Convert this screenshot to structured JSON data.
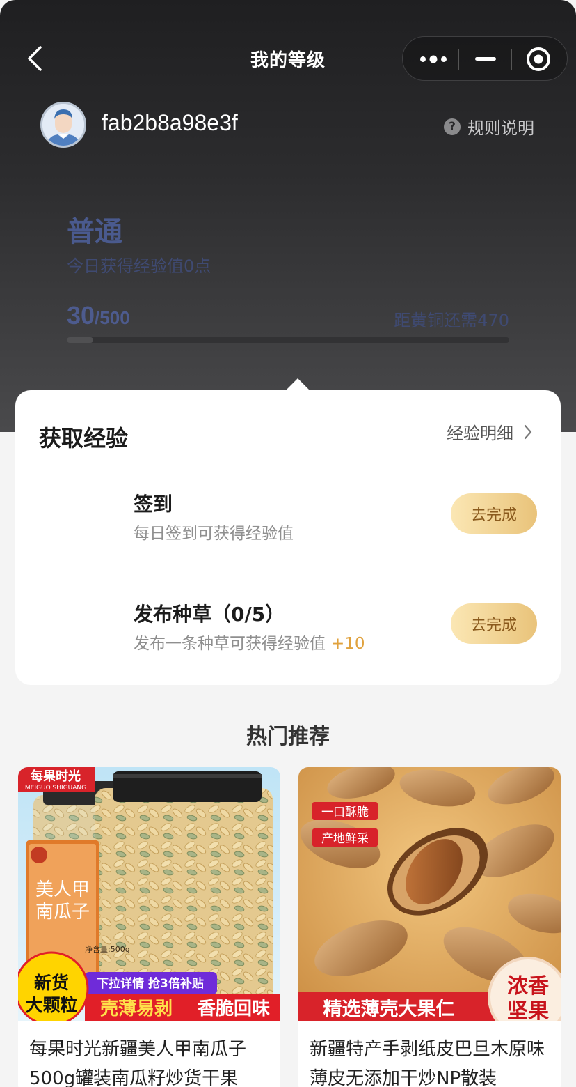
{
  "nav": {
    "title": "我的等级"
  },
  "user": {
    "name": "fab2b8a98e3f",
    "rules_label": "规则说明"
  },
  "level": {
    "name": "普通",
    "today_text": "今日获得经验值0点",
    "current_exp": "30",
    "total_exp": "/500",
    "next_text": "距黄铜还需470",
    "progress_fraction": 0.06
  },
  "card": {
    "title": "获取经验",
    "detail_link": "经验明细",
    "tasks": [
      {
        "title": "签到",
        "desc": "每日签到可获得经验值",
        "bonus": "",
        "button": "去完成"
      },
      {
        "title": "发布种草（0/5）",
        "desc": "发布一条种草可获得经验值",
        "bonus": "+10",
        "button": "去完成"
      }
    ]
  },
  "recommend": {
    "title": "热门推荐",
    "products": [
      {
        "title": "每果时光新疆美人甲南瓜子500g罐装南瓜籽炒货干果",
        "image": {
          "brand": "每果时光",
          "brand_en": "MEIGUO SHIGUANG",
          "label": "美人甲南瓜子",
          "weight": "净含量:500g",
          "badge_top": "新货",
          "badge_bottom": "大颗粒",
          "purple_banner": "下拉详情  抢3倍补贴",
          "red_banner_left": "壳薄易剥",
          "red_banner_right": "香脆回味"
        }
      },
      {
        "title": "新疆特产手剥纸皮巴旦木原味薄皮无添加干炒NP散装",
        "image": {
          "tag1": "一口酥脆",
          "tag2": "产地鲜采",
          "banner": "精选薄壳大果仁",
          "stamp_top": "浓香",
          "stamp_bottom": "坚果"
        }
      }
    ]
  }
}
